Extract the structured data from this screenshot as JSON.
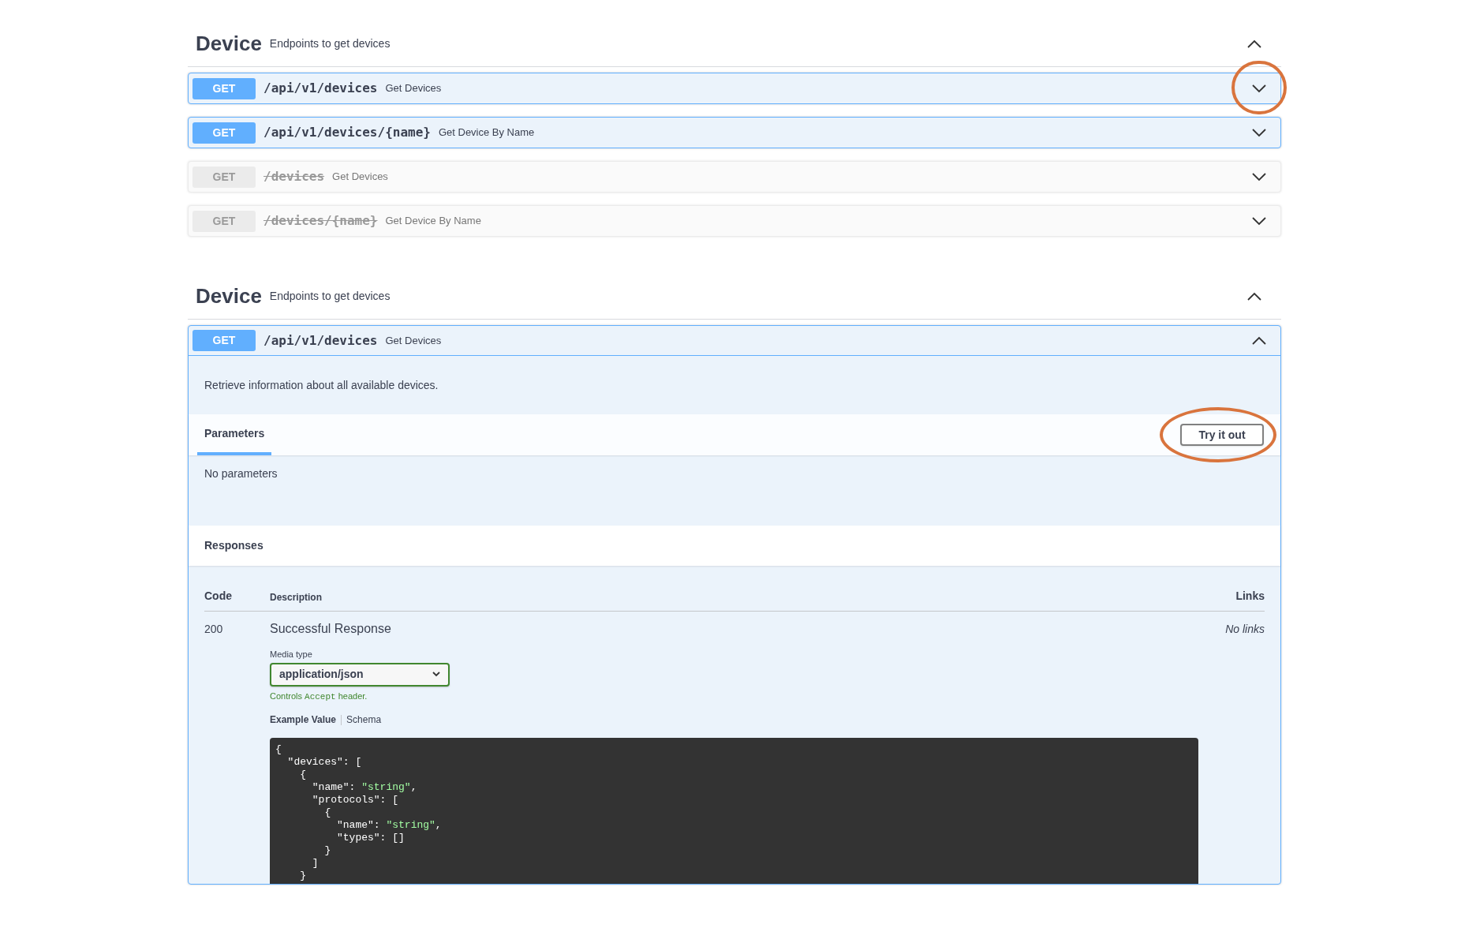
{
  "sections": [
    {
      "title": "Device",
      "description": "Endpoints to get devices",
      "expanded": true,
      "operations": [
        {
          "method": "GET",
          "path": "/api/v1/devices",
          "summary": "Get Devices",
          "deprecated": false,
          "expanded": false,
          "highlighted": true
        },
        {
          "method": "GET",
          "path": "/api/v1/devices/{name}",
          "summary": "Get Device By Name",
          "deprecated": false,
          "expanded": false,
          "highlighted": false
        },
        {
          "method": "GET",
          "path": "/devices",
          "summary": "Get Devices",
          "deprecated": true,
          "expanded": false,
          "highlighted": false
        },
        {
          "method": "GET",
          "path": "/devices/{name}",
          "summary": "Get Device By Name",
          "deprecated": true,
          "expanded": false,
          "highlighted": false
        }
      ]
    },
    {
      "title": "Device",
      "description": "Endpoints to get devices",
      "expanded": true,
      "operations": [
        {
          "method": "GET",
          "path": "/api/v1/devices",
          "summary": "Get Devices",
          "deprecated": false,
          "expanded": true,
          "highlighted": false,
          "details": {
            "description": "Retrieve information about all available devices.",
            "tabs": [
              {
                "label": "Parameters",
                "selected": true
              }
            ],
            "try_button": {
              "label": "Try it out",
              "highlighted": true
            },
            "parameters_text": "No parameters",
            "responses_title": "Responses",
            "columns": [
              "Code",
              "Description",
              "Links"
            ],
            "responses": [
              {
                "code": "200",
                "description": "Successful Response",
                "links": "No links",
                "media_type_label": "Media type",
                "media_type": "application/json",
                "hint_before": "Controls",
                "hint_code": "Accept",
                "hint_after": "header.",
                "example_tabs": [
                  {
                    "label": "Example Value",
                    "selected": true
                  },
                  {
                    "label": "Schema",
                    "selected": false
                  }
                ],
                "code_lines": [
                  [
                    {
                      "t": "{"
                    }
                  ],
                  [
                    {
                      "t": "  \"devices\": ["
                    }
                  ],
                  [
                    {
                      "t": "    {"
                    }
                  ],
                  [
                    {
                      "t": "      \"name\": "
                    },
                    {
                      "t": "\"string\"",
                      "kind": "string"
                    },
                    {
                      "t": ","
                    }
                  ],
                  [
                    {
                      "t": "      \"protocols\": ["
                    }
                  ],
                  [
                    {
                      "t": "        {"
                    }
                  ],
                  [
                    {
                      "t": "          \"name\": "
                    },
                    {
                      "t": "\"string\"",
                      "kind": "string"
                    },
                    {
                      "t": ","
                    }
                  ],
                  [
                    {
                      "t": "          \"types\": []"
                    }
                  ],
                  [
                    {
                      "t": "        }"
                    }
                  ],
                  [
                    {
                      "t": "      ]"
                    }
                  ],
                  [
                    {
                      "t": "    }"
                    }
                  ]
                ]
              }
            ]
          }
        }
      ]
    }
  ]
}
